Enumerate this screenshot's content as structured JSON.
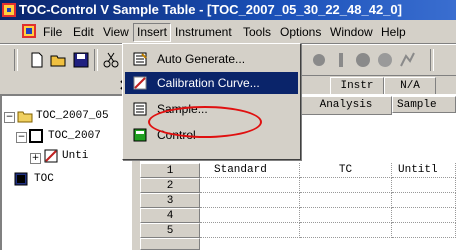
{
  "window": {
    "title": "TOC-Control V Sample Table - [TOC_2007_05_30_22_48_42_0]"
  },
  "menubar": {
    "items": [
      {
        "label": "File"
      },
      {
        "label": "Edit"
      },
      {
        "label": "View"
      },
      {
        "label": "Insert"
      },
      {
        "label": "Instrument"
      },
      {
        "label": "Tools"
      },
      {
        "label": "Options"
      },
      {
        "label": "Window"
      },
      {
        "label": "Help"
      }
    ]
  },
  "insert_menu": {
    "items": [
      {
        "label": "Auto Generate...",
        "icon": "auto-generate-icon"
      },
      {
        "label": "Calibration Curve...",
        "icon": "calibration-curve-icon",
        "highlighted": true
      },
      {
        "label": "Sample...",
        "icon": "sample-icon",
        "circled": true
      },
      {
        "label": "Control",
        "icon": "control-icon"
      }
    ]
  },
  "tree": {
    "items": [
      {
        "label": "TOC_2007_05",
        "icon": "folder-icon"
      },
      {
        "label": "TOC_2007",
        "icon": "table-icon"
      },
      {
        "label": "Unti",
        "icon": "curve-icon"
      },
      {
        "label": "TOC",
        "icon": "instrument-icon"
      }
    ]
  },
  "grid": {
    "top_labels": [
      "Instr",
      "N/A"
    ],
    "columns": [
      "Analysis",
      "Sample"
    ],
    "rows": [
      {
        "num": "1",
        "type": "Standard",
        "analysis": "TC",
        "sample": "Untitl"
      },
      {
        "num": "2",
        "type": "",
        "analysis": "",
        "sample": ""
      },
      {
        "num": "3",
        "type": "",
        "analysis": "",
        "sample": ""
      },
      {
        "num": "4",
        "type": "",
        "analysis": "",
        "sample": ""
      },
      {
        "num": "5",
        "type": "",
        "analysis": "",
        "sample": ""
      }
    ]
  },
  "colors": {
    "titlebar": "#0a246a",
    "highlight": "#0a246a",
    "circle": "#e01010"
  }
}
